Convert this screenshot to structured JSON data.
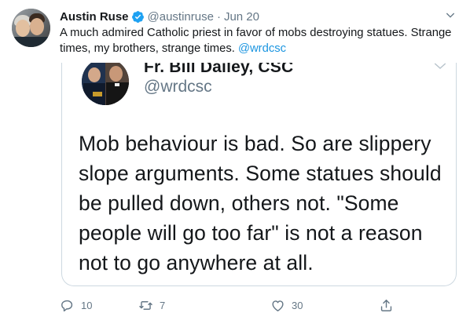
{
  "tweet": {
    "author": {
      "name": "Austin Ruse",
      "handle": "@austinruse",
      "verified": true,
      "avatar_icon": "user-avatar-photo"
    },
    "separator": "·",
    "date": "Jun 20",
    "text": "A much admired Catholic priest in favor of mobs destroying statues. Strange times, my brothers, strange times. ",
    "mention": "@wrdcsc",
    "quoted": {
      "name": "Fr. Bill Dailey, CSC",
      "handle": "@wrdcsc",
      "text": "Mob behaviour is bad. So are slippery slope arguments. Some statues should be pulled down, others not. \"Some people will go too far\" is not a reason not to go anywhere at all."
    },
    "actions": {
      "reply_count": "10",
      "retweet_count": "7",
      "like_count": "30",
      "reply_icon": "reply-icon",
      "retweet_icon": "retweet-icon",
      "like_icon": "heart-icon",
      "share_icon": "share-icon"
    },
    "colors": {
      "link": "#1b95e0",
      "secondary_text": "#657786",
      "verified_badge": "#1da1f2",
      "border": "#cdd8e0"
    }
  }
}
